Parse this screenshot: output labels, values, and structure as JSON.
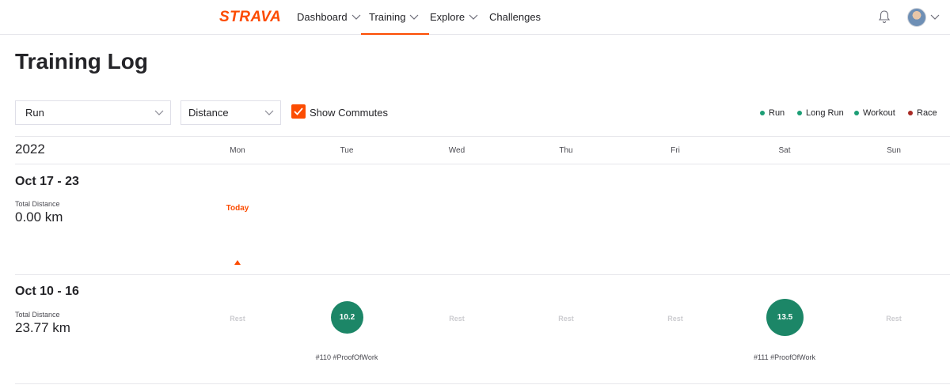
{
  "nav": {
    "logo": "STRAVA",
    "items": [
      {
        "label": "Dashboard"
      },
      {
        "label": "Training"
      },
      {
        "label": "Explore"
      },
      {
        "label": "Challenges"
      }
    ],
    "active": "Training",
    "icons": [
      "bell-icon",
      "avatar",
      "chevron-down-icon"
    ]
  },
  "page": {
    "title": "Training Log"
  },
  "filters": {
    "sport": "Run",
    "metric": "Distance",
    "show_commutes_label": "Show Commutes",
    "show_commutes_checked": true
  },
  "legend": [
    {
      "label": "Run",
      "color": "#1c9e75"
    },
    {
      "label": "Long Run",
      "color": "#1c9e75"
    },
    {
      "label": "Workout",
      "color": "#1c9e75"
    },
    {
      "label": "Race",
      "color": "#a82a24"
    }
  ],
  "calendar": {
    "year": "2022",
    "days": [
      "Mon",
      "Tue",
      "Wed",
      "Thu",
      "Fri",
      "Sat",
      "Sun"
    ],
    "today_label": "Today",
    "weeks": [
      {
        "title": "Oct 17 - 23",
        "total_label": "Total Distance",
        "total_value": "0.00 km"
      },
      {
        "title": "Oct 10 - 16",
        "total_label": "Total Distance",
        "total_value": "23.77 km",
        "cells": [
          {
            "day": "Mon",
            "rest": "Rest"
          },
          {
            "day": "Tue",
            "value": "10.2",
            "caption": "#110 #ProofOfWork"
          },
          {
            "day": "Wed",
            "rest": "Rest"
          },
          {
            "day": "Thu",
            "rest": "Rest"
          },
          {
            "day": "Fri",
            "rest": "Rest"
          },
          {
            "day": "Sat",
            "value": "13.5",
            "caption": "#111 #ProofOfWork"
          },
          {
            "day": "Sun",
            "rest": "Rest"
          }
        ]
      }
    ]
  },
  "colors": {
    "accent": "#fc4c02",
    "activity": "#1c8667"
  }
}
